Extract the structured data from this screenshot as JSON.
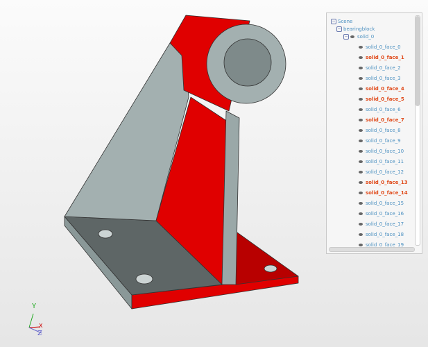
{
  "scene_tree": {
    "root": "Scene",
    "group": "bearingblock",
    "solid": "solid_0",
    "faces": [
      {
        "label": "solid_0_face_0",
        "highlighted": false
      },
      {
        "label": "solid_0_face_1",
        "highlighted": true
      },
      {
        "label": "solid_0_face_2",
        "highlighted": false
      },
      {
        "label": "solid_0_face_3",
        "highlighted": false
      },
      {
        "label": "solid_0_face_4",
        "highlighted": true
      },
      {
        "label": "solid_0_face_5",
        "highlighted": true
      },
      {
        "label": "solid_0_face_6",
        "highlighted": false
      },
      {
        "label": "solid_0_face_7",
        "highlighted": true
      },
      {
        "label": "solid_0_face_8",
        "highlighted": false
      },
      {
        "label": "solid_0_face_9",
        "highlighted": false
      },
      {
        "label": "solid_0_face_10",
        "highlighted": false
      },
      {
        "label": "solid_0_face_11",
        "highlighted": false
      },
      {
        "label": "solid_0_face_12",
        "highlighted": false
      },
      {
        "label": "solid_0_face_13",
        "highlighted": true
      },
      {
        "label": "solid_0_face_14",
        "highlighted": true
      },
      {
        "label": "solid_0_face_15",
        "highlighted": false
      },
      {
        "label": "solid_0_face_16",
        "highlighted": false
      },
      {
        "label": "solid_0_face_17",
        "highlighted": false
      },
      {
        "label": "solid_0_face_18",
        "highlighted": false
      },
      {
        "label": "solid_0_face_19",
        "highlighted": false
      }
    ]
  },
  "axes": {
    "x": "X",
    "y": "Y",
    "z": "Z"
  },
  "colors": {
    "selected_face": "#e00000",
    "model": "#9aa8a8",
    "highlight_text": "#e04a1a",
    "tree_text": "#4a8fc0"
  }
}
